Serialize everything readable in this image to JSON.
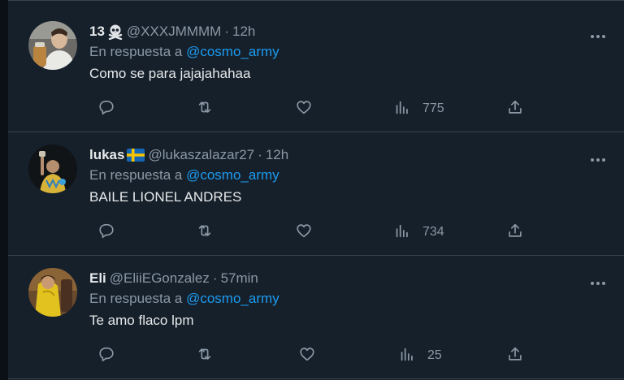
{
  "colors": {
    "background": "#15202b",
    "divider": "#38444d",
    "text": "#e7e9ea",
    "muted": "#8b98a5",
    "accent": "#1d9bf0"
  },
  "icons": [
    "more-icon",
    "reply-icon",
    "retweet-icon",
    "like-icon",
    "views-icon",
    "share-icon"
  ],
  "tweets": [
    {
      "name": "13",
      "badge_icon": "skull-crossbones-emoji",
      "handle": "@XXXJMMMM",
      "separator": "·",
      "time": "12h",
      "reply_prefix": "En respuesta a",
      "reply_to": "@cosmo_army",
      "text": "Como se para jajajahahaa",
      "views": "775"
    },
    {
      "name": "lukas",
      "badge_icon": "sweden-flag-emoji",
      "handle": "@lukaszalazar27",
      "separator": "·",
      "time": "12h",
      "reply_prefix": "En respuesta a",
      "reply_to": "@cosmo_army",
      "text": "BAILE LIONEL ANDRES",
      "views": "734"
    },
    {
      "name": "Eli",
      "badge_icon": "",
      "handle": "@EliiEGonzalez",
      "separator": "·",
      "time": "57min",
      "reply_prefix": "En respuesta a",
      "reply_to": "@cosmo_army",
      "text": "Te amo flaco lpm",
      "views": "25"
    }
  ]
}
